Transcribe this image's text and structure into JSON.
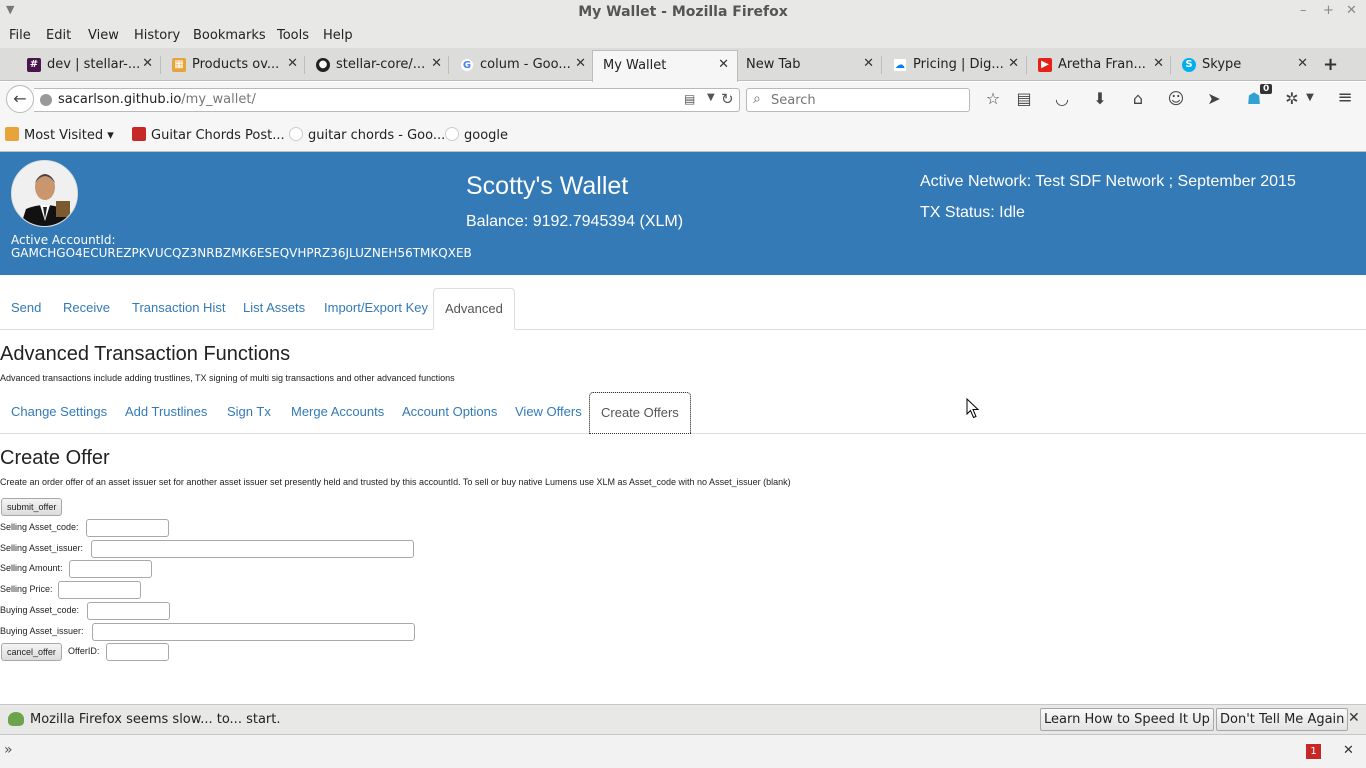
{
  "window": {
    "title": "My Wallet - Mozilla Firefox"
  },
  "menu": [
    "File",
    "Edit",
    "View",
    "History",
    "Bookmarks",
    "Tools",
    "Help"
  ],
  "tabs": [
    {
      "label": "dev | stellar-...",
      "icon": "slack-icon",
      "color": "#4a154b"
    },
    {
      "label": "Products ov...",
      "icon": "products-icon",
      "color": "#e8a33b"
    },
    {
      "label": "stellar-core/...",
      "icon": "github-icon",
      "color": "#222222"
    },
    {
      "label": "colum - Goo...",
      "icon": "google-icon",
      "color": "#4285f4"
    },
    {
      "label": "My Wallet",
      "icon": "",
      "color": ""
    },
    {
      "label": "New Tab",
      "icon": "",
      "color": ""
    },
    {
      "label": "Pricing | Dig...",
      "icon": "cloud-icon",
      "color": "#0080ff"
    },
    {
      "label": "Aretha Fran...",
      "icon": "youtube-icon",
      "color": "#e62117"
    },
    {
      "label": "Skype",
      "icon": "skype-icon",
      "color": "#00aff0"
    }
  ],
  "nav": {
    "url_host": "sacarlson.github.io",
    "url_path": "/my_wallet/",
    "search_placeholder": "Search",
    "badge_count": "0"
  },
  "bookmarks": [
    {
      "label": "Most Visited ▾",
      "icon": "folder-icon",
      "color": "#e8a33b"
    },
    {
      "label": "Guitar Chords Post...",
      "icon": "ap-icon",
      "color": "#c62828"
    },
    {
      "label": "guitar chords - Goo...",
      "icon": "google-icon",
      "color": "#4285f4"
    },
    {
      "label": "google",
      "icon": "google-icon",
      "color": "#4285f4"
    }
  ],
  "hero": {
    "wallet_title": "Scotty's Wallet",
    "balance": "Balance: 9192.7945394 (XLM)",
    "active_network": "Active Network: Test SDF Network ; September 2015",
    "tx_status": "TX Status: Idle",
    "account_label": "Active AccountId:",
    "account_id": "GAMCHGO4ECUREZPKVUCQZ3NRBZMK6ESEQVHPRZ36JLUZNEH56TMKQXEB"
  },
  "main_tabs": [
    "Send",
    "Receive",
    "Transaction Hist",
    "List Assets",
    "Import/Export Key",
    "Advanced"
  ],
  "advanced": {
    "heading": "Advanced Transaction Functions",
    "description": "Advanced transactions include adding trustlines, TX signing of multi sig transactions and other advanced functions",
    "sub_tabs": [
      "Change Settings",
      "Add Trustlines",
      "Sign Tx",
      "Merge Accounts",
      "Account Options",
      "View Offers",
      "Create Offers"
    ]
  },
  "create_offer": {
    "heading": "Create Offer",
    "description": "Create an order offer of an asset issuer set for another asset issuer set presently held and trusted by this accountId. To sell or buy native Lumens use XLM as Asset_code with no Asset_issuer (blank)",
    "submit_label": "submit_offer",
    "cancel_label": "cancel_offer",
    "fields": {
      "selling_code": "Selling Asset_code:",
      "selling_issuer": "Selling Asset_issuer:",
      "selling_amount": "Selling Amount:",
      "selling_price": "Selling Price:",
      "buying_code": "Buying Asset_code:",
      "buying_issuer": "Buying Asset_issuer:",
      "offer_id": "OfferID:"
    }
  },
  "notification": {
    "message": "Mozilla Firefox seems slow... to... start.",
    "learn_button": "Learn How to Speed It Up",
    "dismiss_button": "Don't Tell Me Again"
  },
  "addon_bar": {
    "badge": "1"
  },
  "colors": {
    "hero_bg": "#337ab7",
    "link": "#337ab7"
  }
}
